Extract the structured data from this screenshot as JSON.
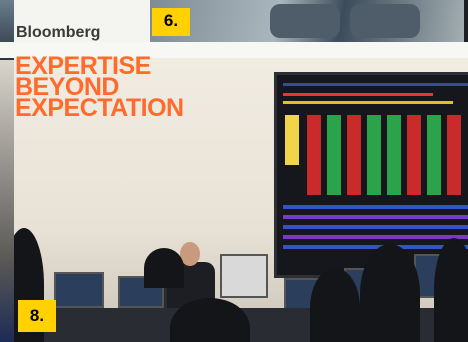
{
  "labels": {
    "six": "6.",
    "eight": "8."
  },
  "wall_text": {
    "brand": "Bloomberg",
    "slogan_line1": "EXPERTISE",
    "slogan_line2": "BEYOND",
    "slogan_line3": "EXPECTATION"
  },
  "colors": {
    "slogan": "#ff6b2c",
    "label_bg": "#ffd100"
  }
}
